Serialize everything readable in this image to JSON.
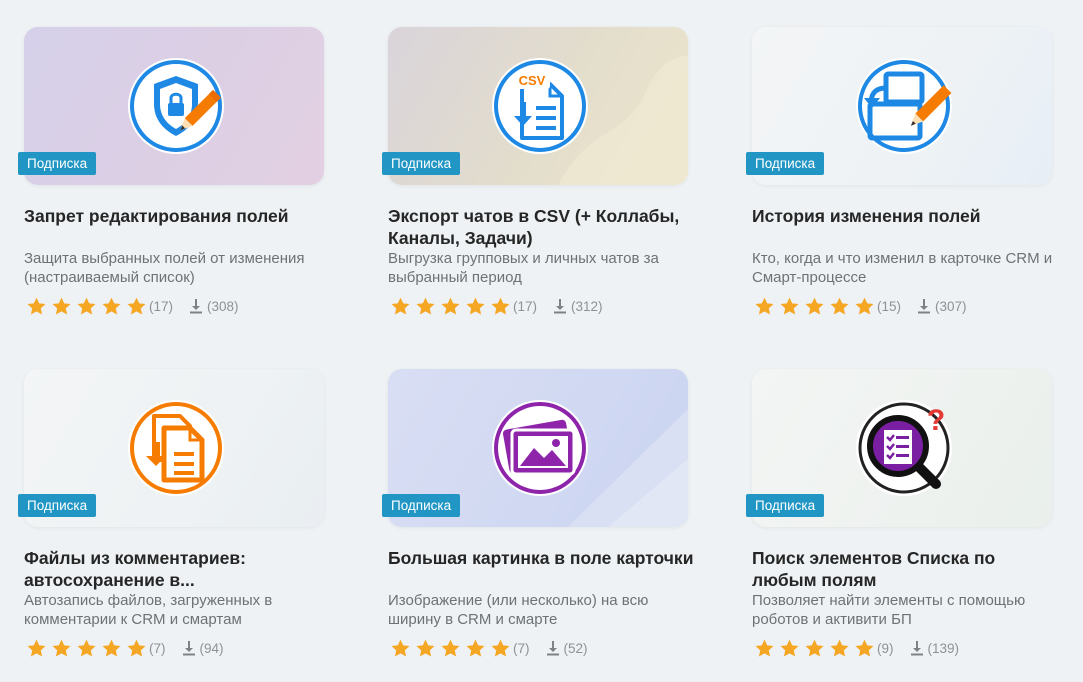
{
  "badge_label": "Подписка",
  "colors": {
    "badge": "#2196c4",
    "star": "#f5a623"
  },
  "apps": [
    {
      "icon": "shield-lock-pencil-icon",
      "title": "Запрет редактирования полей",
      "description": "Защита выбранных полей от изменения (настраиваемый список)",
      "stars": 5,
      "reviews": "(17)",
      "downloads": "(308)"
    },
    {
      "icon": "csv-document-icon",
      "title": "Экспорт чатов в CSV (+ Коллабы, Каналы, Задачи)",
      "description": "Выгрузка групповых и личных чатов за выбранный период",
      "stars": 5,
      "reviews": "(17)",
      "downloads": "(312)"
    },
    {
      "icon": "history-pencil-icon",
      "title": "История изменения полей",
      "description": "Кто, когда и что изменил в карточке CRM и Смарт-процессе",
      "stars": 5,
      "reviews": "(15)",
      "downloads": "(307)"
    },
    {
      "icon": "file-download-icon",
      "title": "Файлы из комментариев: автосохранение в...",
      "description": "Автозапись файлов, загруженных в комментарии к CRM и смартам",
      "stars": 5,
      "reviews": "(7)",
      "downloads": "(94)"
    },
    {
      "icon": "picture-gallery-icon",
      "title": "Большая картинка в поле карточки",
      "description": "Изображение (или несколько) на всю ширину в CRM и смарте",
      "stars": 5,
      "reviews": "(7)",
      "downloads": "(52)"
    },
    {
      "icon": "list-search-question-icon",
      "title": "Поиск элементов Списка по любым полям",
      "description": "Позволяет найти элементы с помощью роботов и активити БП",
      "stars": 5,
      "reviews": "(9)",
      "downloads": "(139)"
    }
  ]
}
